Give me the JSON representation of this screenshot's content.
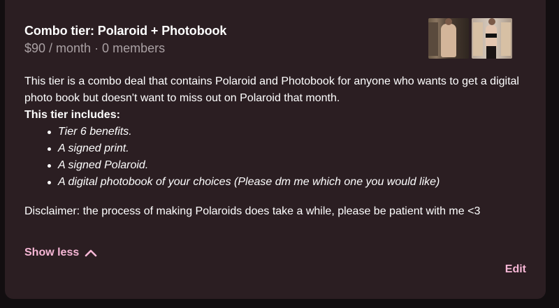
{
  "tier": {
    "title": "Combo tier: Polaroid + Photobook",
    "meta": "$90 / month · 0 members",
    "thumbnails": [
      "tier-photo-1",
      "tier-photo-2",
      "tier-photo-3"
    ]
  },
  "description": {
    "intro": "This tier is a combo deal that contains Polaroid and Photobook for anyone who wants to get a digital photo book but doesn't want to miss out on Polaroid that month.",
    "includes_title": "This tier includes:",
    "benefits": [
      "Tier 6 benefits.",
      "A signed print.",
      "A signed Polaroid.",
      "A digital photobook of your choices (Please dm me which one you would like)"
    ],
    "disclaimer": "Disclaimer: the process of making Polaroids does take a while, please be patient with me <3"
  },
  "actions": {
    "show_less": "Show less",
    "edit": "Edit"
  },
  "colors": {
    "card_bg": "#2b1e22",
    "accent_pink": "#f7b7d6",
    "muted_text": "#a9a0a3"
  }
}
